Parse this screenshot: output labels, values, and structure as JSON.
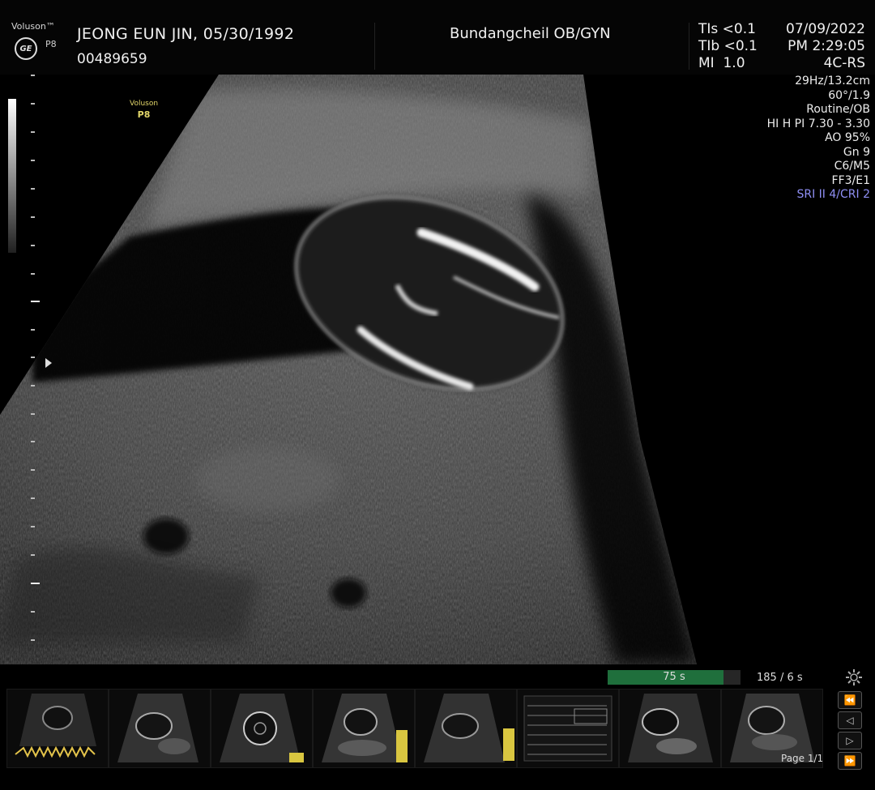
{
  "header": {
    "brand": "Voluson™",
    "probe_model": "P8",
    "patient_line": "JEONG EUN JIN,  05/30/1992",
    "patient_id": "00489659",
    "institution": "Bundangcheil OB/GYN",
    "safety": {
      "tis": "TIs <0.1",
      "tib": "TIb <0.1",
      "mi": "MI  1.0"
    },
    "date": "07/09/2022",
    "time": "PM 2:29:05",
    "probe": "4C-RS"
  },
  "image_overlay": {
    "voluson_tag": "Voluson",
    "voluson_model": "P8"
  },
  "params": [
    "29Hz/13.2cm",
    "60°/1.9",
    "Routine/OB",
    "HI H PI 7.30 - 3.30",
    "AO 95%",
    "Gn  9",
    "C6/M5",
    "FF3/E1",
    "SRI II 4/CRI 2"
  ],
  "cine": {
    "current_label": "75 s",
    "progress": 0.87,
    "total_label": "185 / 6 s"
  },
  "thumbnails": {
    "count": 8,
    "page_label": "Page 1/1"
  },
  "nav": {
    "first": "⏪",
    "prev": "◁",
    "next": "▷",
    "last": "⏩"
  },
  "colors": {
    "background": "#000000",
    "text": "#f0f0f0",
    "voluson_tag": "#e3d76a",
    "sri": "#8f8ff5",
    "cine_fill": "#1f6f3c"
  },
  "icons": [
    "ge-logo-icon",
    "settings-gear-icon",
    "first-frame-icon",
    "prev-frame-icon",
    "next-frame-icon",
    "last-frame-icon"
  ]
}
